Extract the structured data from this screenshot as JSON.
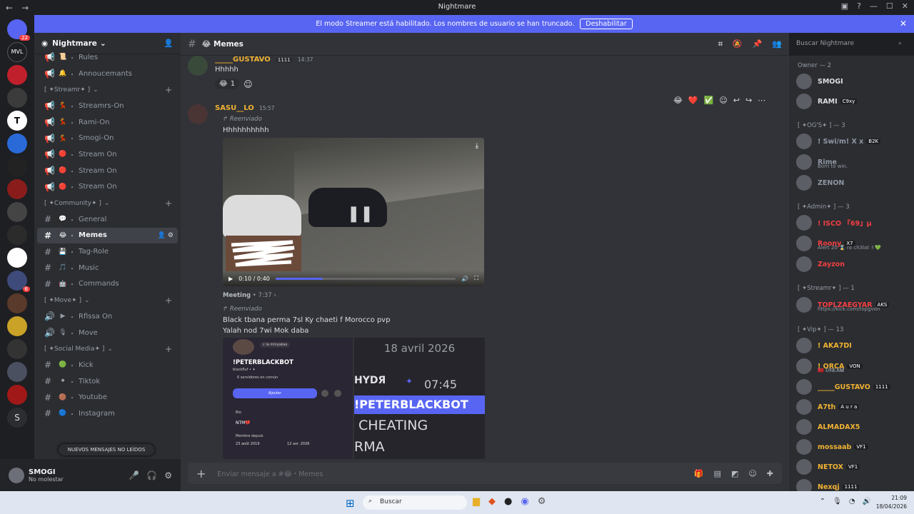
{
  "window": {
    "title": "Nightmare"
  },
  "banner": {
    "text": "El modo Streamer está habilitado. Los nombres de usuario se han truncado.",
    "button": "Deshabilitar"
  },
  "guilds": {
    "badge_top": "22",
    "badge_mid": "6",
    "letter": "S"
  },
  "server": {
    "name": "Nightmare"
  },
  "channels": [
    {
      "kind": "ch",
      "icon": "📜",
      "name": "Rules",
      "type": "announce"
    },
    {
      "kind": "ch",
      "icon": "🔔",
      "name": "Annoucemants",
      "type": "announce"
    },
    {
      "kind": "cat",
      "name": "[ ✦Streamr✦ ]"
    },
    {
      "kind": "ch",
      "icon": "💃",
      "name": "Streamrs-On",
      "type": "announce"
    },
    {
      "kind": "ch",
      "icon": "💃",
      "name": "Rami-On",
      "type": "announce"
    },
    {
      "kind": "ch",
      "icon": "💃",
      "name": "Smogi-On",
      "type": "announce"
    },
    {
      "kind": "ch",
      "icon": "🔴",
      "name": "Stream On",
      "type": "announce"
    },
    {
      "kind": "ch",
      "icon": "🔴",
      "name": "Stream On",
      "type": "announce"
    },
    {
      "kind": "ch",
      "icon": "🔴",
      "name": "Stream On",
      "type": "announce"
    },
    {
      "kind": "cat",
      "name": "[ ✦Community✦ ]"
    },
    {
      "kind": "ch",
      "icon": "💬",
      "name": "General",
      "type": "text"
    },
    {
      "kind": "ch",
      "icon": "😂",
      "name": "Memes",
      "type": "text",
      "active": true
    },
    {
      "kind": "ch",
      "icon": "💾",
      "name": "Tag-Role",
      "type": "text"
    },
    {
      "kind": "ch",
      "icon": "🎵",
      "name": "Music",
      "type": "text"
    },
    {
      "kind": "ch",
      "icon": "🤖",
      "name": "Commands",
      "type": "text"
    },
    {
      "kind": "cat",
      "name": "[ ✦Move✦ ]"
    },
    {
      "kind": "ch",
      "icon": "▶",
      "name": "Rfissa On",
      "type": "voice"
    },
    {
      "kind": "ch",
      "icon": "🎙",
      "name": "Move",
      "type": "voice"
    },
    {
      "kind": "cat",
      "name": "[ ✦Social Media✦ ]"
    },
    {
      "kind": "ch",
      "icon": "🟢",
      "name": "Kick",
      "type": "text"
    },
    {
      "kind": "ch",
      "icon": "⚫",
      "name": "Tiktok",
      "type": "text"
    },
    {
      "kind": "ch",
      "icon": "🟤",
      "name": "Youtube",
      "type": "text"
    },
    {
      "kind": "ch",
      "icon": "🔵",
      "name": "Instagram",
      "type": "text"
    }
  ],
  "new_messages": "NUEVOS MENSAJES NO LEÍDOS",
  "user": {
    "name": "SMOGI",
    "status": "No molestar"
  },
  "chat": {
    "channel": "Memes",
    "search_placeholder": "Buscar Nightmare",
    "composer_placeholder": "Enviar mensaje a #😂・Memes",
    "messages": [
      {
        "author": "_____GUSTAVO",
        "tag": "1111",
        "time": "14:37",
        "text": "Hhhhh",
        "reaction_count": "1"
      },
      {
        "author": "SASU__LO",
        "time": "15:57",
        "forwarded": "Reenviado",
        "text": "Hhhhhhhhhh",
        "video_time": "0:10 / 0:40",
        "video_progress": 0.26,
        "meeting": "Meeting",
        "meeting_time": "7:37",
        "forwarded2": "Reenviado",
        "text2a": "Black tbana perma 7sl Ky chaeti f Morocco pvp",
        "text2b": "Yalah nod 7wi Mok daba"
      }
    ],
    "img1": {
      "pill": "c la minyakas",
      "name": "!PETERBLACKBOT",
      "sub": "blackfluf • ✦",
      "servers": "6 servidores en común",
      "btn": "Ajouter",
      "bio_label": "Bio",
      "bio": "NTM💔",
      "member_label": "Membre depuis",
      "date1": "23 août 2019",
      "date2": "12 avr. 2026"
    },
    "img2": {
      "date": "18 avril 2026",
      "hydra": "HYDЯ",
      "time": "07:45",
      "bot": "!PETERBLACKBOT",
      "line1": "CHEATING",
      "line2": "RMA"
    }
  },
  "members": {
    "groups": [
      {
        "title": "Owner — 2",
        "items": [
          {
            "name": "SMOGI",
            "color": "#dbdee1"
          },
          {
            "name": "RAMI",
            "color": "#dbdee1",
            "badge": "C9xy"
          }
        ]
      },
      {
        "title": "[ ✦OG'S✦ ] — 3",
        "items": [
          {
            "name": "! Swi/m! X x",
            "color": "#8f97a3",
            "badge": "B2K"
          },
          {
            "name": "Rime",
            "color": "#8f97a3",
            "sub": "Born to win."
          },
          {
            "name": "ZENON",
            "color": "#8f97a3"
          }
        ]
      },
      {
        "title": "[ ✦Admin✦ ] — 3",
        "items": [
          {
            "name": "! ISCO 『69』μ",
            "color": "#f23f43"
          },
          {
            "name": "Roony",
            "color": "#f23f43",
            "badge": "X7",
            "sub": "Alert 20 ⌛ ra ch3lat ✌💚"
          },
          {
            "name": "Zayzon",
            "color": "#f23f43"
          }
        ]
      },
      {
        "title": "[ ✦Streamr✦ ] — 1",
        "items": [
          {
            "name": "TOPLZAEGYAR",
            "color": "#f23f43",
            "badge": "AKS",
            "sub": "https://kick.com/topgvon"
          }
        ]
      },
      {
        "title": "[ ✦Vip✦ ] — 13",
        "items": [
          {
            "name": "! AKA7DI",
            "color": "#f0b232"
          },
          {
            "name": "! ORCA",
            "color": "#f0b232",
            "badge": "VON",
            "sub": "🇲🇦 Ð𝐑𝐄𝐀𝐌"
          },
          {
            "name": "_____GUSTAVO",
            "color": "#f0b232",
            "badge": "1111"
          },
          {
            "name": "A7th",
            "color": "#f0b232",
            "badge": "A u r a"
          },
          {
            "name": "ALMADAX5",
            "color": "#f0b232"
          },
          {
            "name": "mossaab",
            "color": "#f0b232",
            "badge": "VF1"
          },
          {
            "name": "NETOX",
            "color": "#f0b232",
            "badge": "VF1"
          },
          {
            "name": "Nexqj",
            "color": "#f0b232",
            "badge": "1111"
          }
        ]
      }
    ]
  },
  "taskbar": {
    "search": "Buscar",
    "time": "21:09",
    "date": "18/04/2026"
  }
}
